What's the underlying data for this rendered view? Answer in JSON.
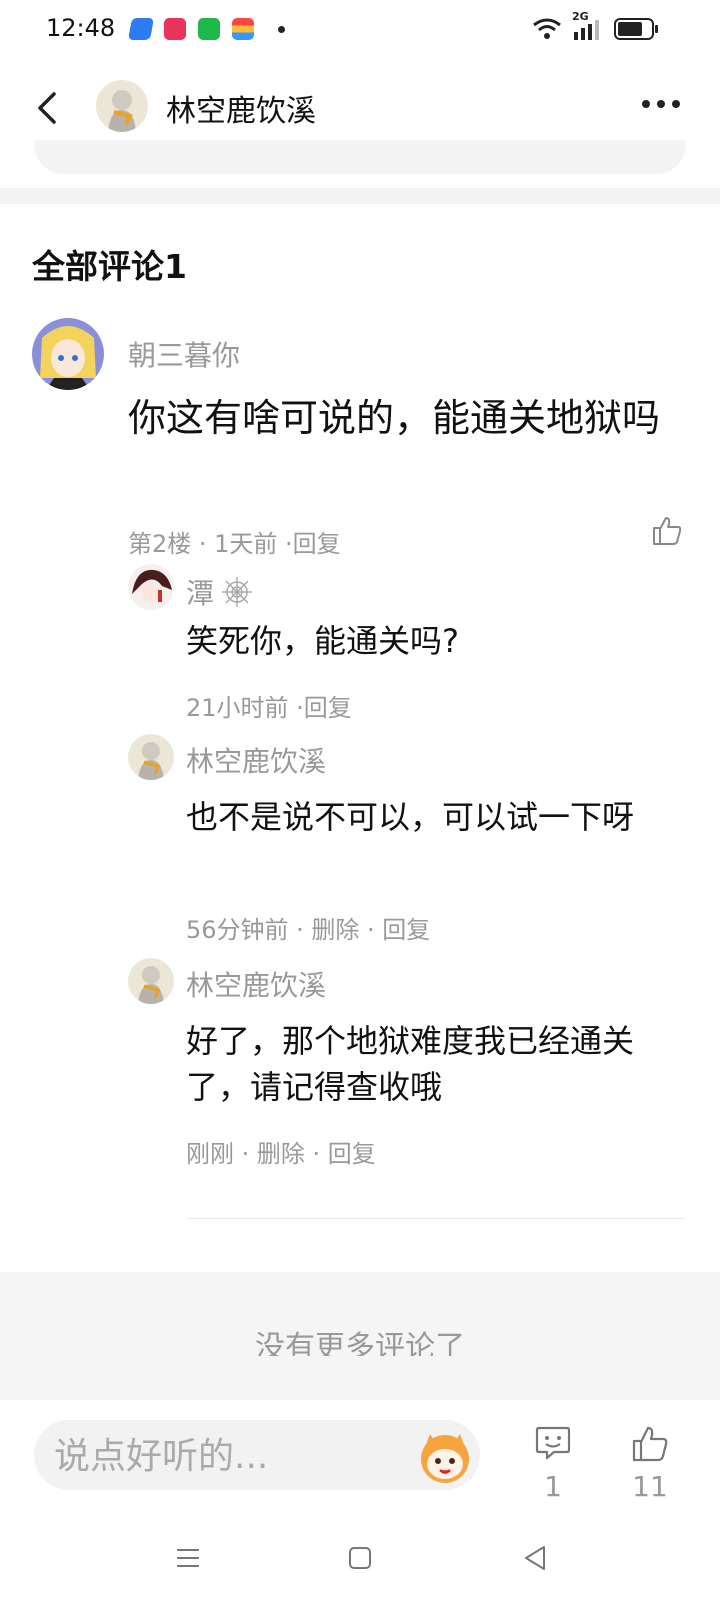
{
  "status_bar": {
    "time": "12:48",
    "signal_label": "2G"
  },
  "header": {
    "title": "林空鹿饮溪"
  },
  "section_title": "全部评论1",
  "comment": {
    "author": "朝三暮你",
    "text": "你这有啥可说的，能通关地狱吗",
    "meta": "第2楼 · 1天前 ·回复"
  },
  "replies": [
    {
      "author": "潭",
      "text": "笑死你，能通关吗?",
      "meta": "21小时前 ·回复"
    },
    {
      "author": "林空鹿饮溪",
      "text": "也不是说不可以，可以试一下呀",
      "meta": "56分钟前 · 删除 · 回复"
    },
    {
      "author": "林空鹿饮溪",
      "text": "好了，那个地狱难度我已经通关了，请记得查收哦",
      "meta": "刚刚 · 删除 · 回复"
    }
  ],
  "no_more": "没有更多评论了",
  "bottom_bar": {
    "placeholder": "说点好听的...",
    "comment_count": "1",
    "like_count": "11"
  }
}
